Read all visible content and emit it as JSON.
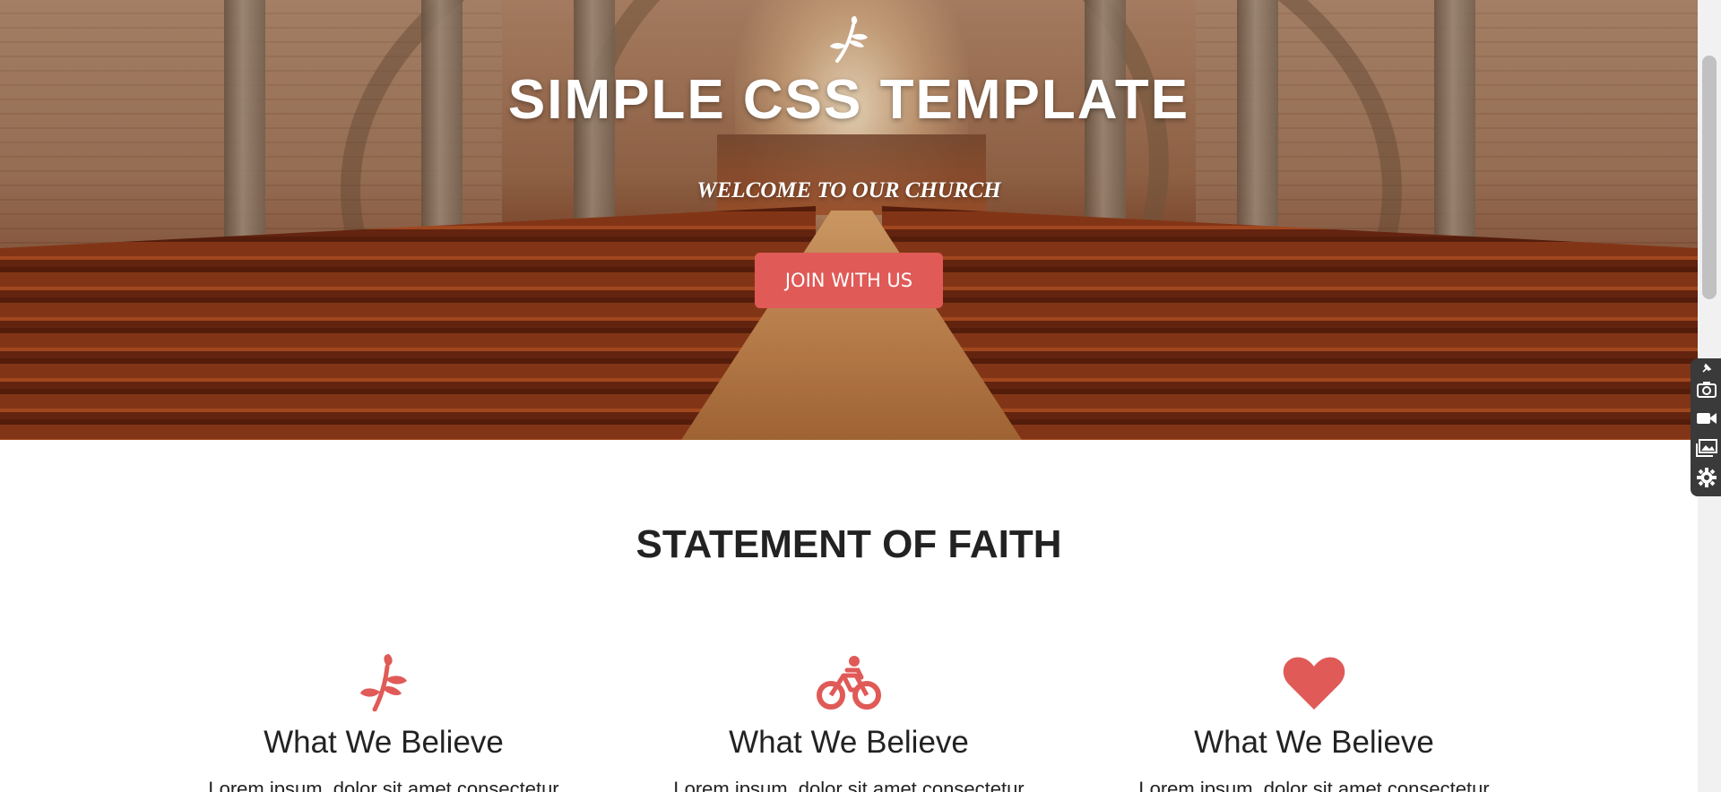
{
  "hero": {
    "logo_icon": "leaf-sprig-icon",
    "title": "SIMPLE CSS TEMPLATE",
    "subtitle": "WELCOME TO OUR CHURCH",
    "button_label": "JOIN WITH US"
  },
  "faith": {
    "title": "STATEMENT OF FAITH",
    "items": [
      {
        "icon": "leaf-sprig-icon",
        "heading": "What We Believe",
        "text": "Lorem ipsum, dolor sit amet consectetur"
      },
      {
        "icon": "bicycle-rider-icon",
        "heading": "What We Believe",
        "text": "Lorem ipsum, dolor sit amet consectetur"
      },
      {
        "icon": "heart-icon",
        "heading": "What We Believe",
        "text": "Lorem ipsum, dolor sit amet consectetur"
      }
    ]
  },
  "side_tools": [
    "pin-icon",
    "camera-icon",
    "video-icon",
    "gallery-icon",
    "gear-icon"
  ],
  "colors": {
    "accent": "#e05a57",
    "heading_text": "#222222",
    "tools_panel": "#3a3a3a"
  }
}
